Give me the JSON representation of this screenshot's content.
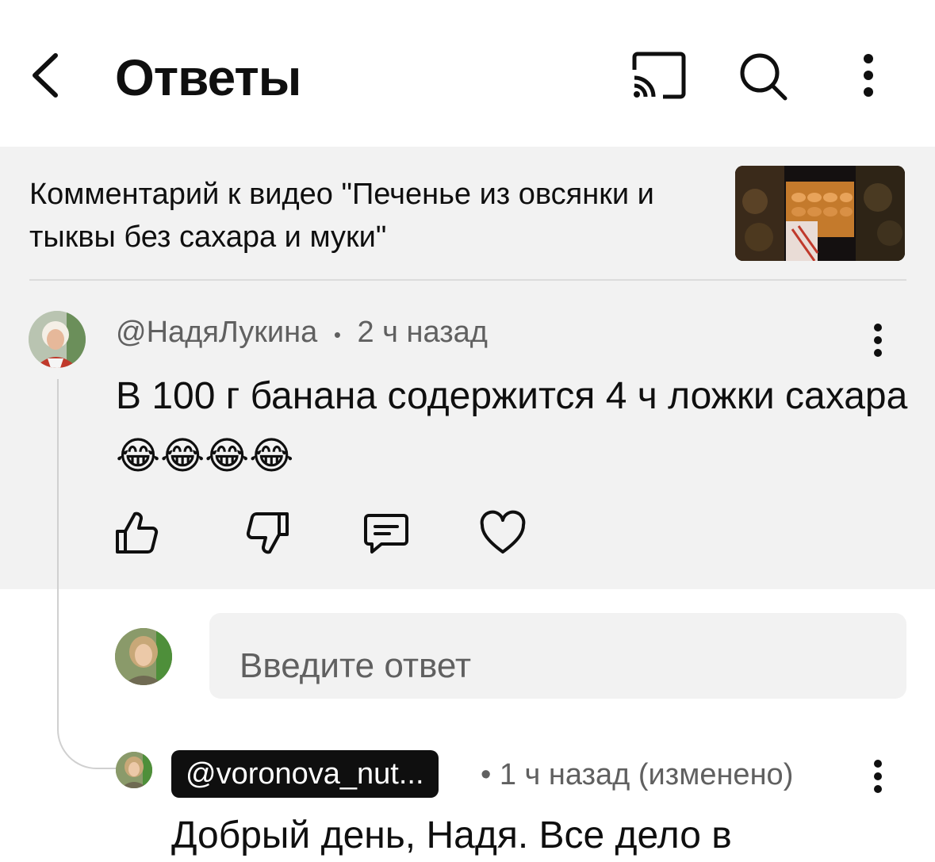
{
  "header": {
    "title": "Ответы",
    "back_icon": "chevron-left-icon",
    "cast_icon": "cast-icon",
    "search_icon": "search-icon",
    "more_icon": "more-vertical-icon"
  },
  "video": {
    "context_text": "Комментарий к видео \"Печенье из овсянки и тыквы без сахара и муки\""
  },
  "parent_comment": {
    "author": "@НадяЛукина",
    "separator": "•",
    "time": "2 ч назад",
    "text": "В 100 г банана содержится 4 ч ложки сахара😂😂😂😂",
    "actions": {
      "like_icon": "thumbs-up-icon",
      "dislike_icon": "thumbs-down-icon",
      "reply_icon": "comment-icon",
      "heart_icon": "heart-icon"
    }
  },
  "reply_box": {
    "placeholder": "Введите ответ"
  },
  "reply_comment": {
    "author": "@voronova_nut...",
    "meta": "• 1 ч назад (изменено)",
    "text": "Добрый день, Надя. Все дело в"
  },
  "colors": {
    "panel_bg": "#f2f2f2",
    "text_primary": "#0f0f0f",
    "text_secondary": "#606060",
    "badge_bg": "#0f0f0f"
  }
}
